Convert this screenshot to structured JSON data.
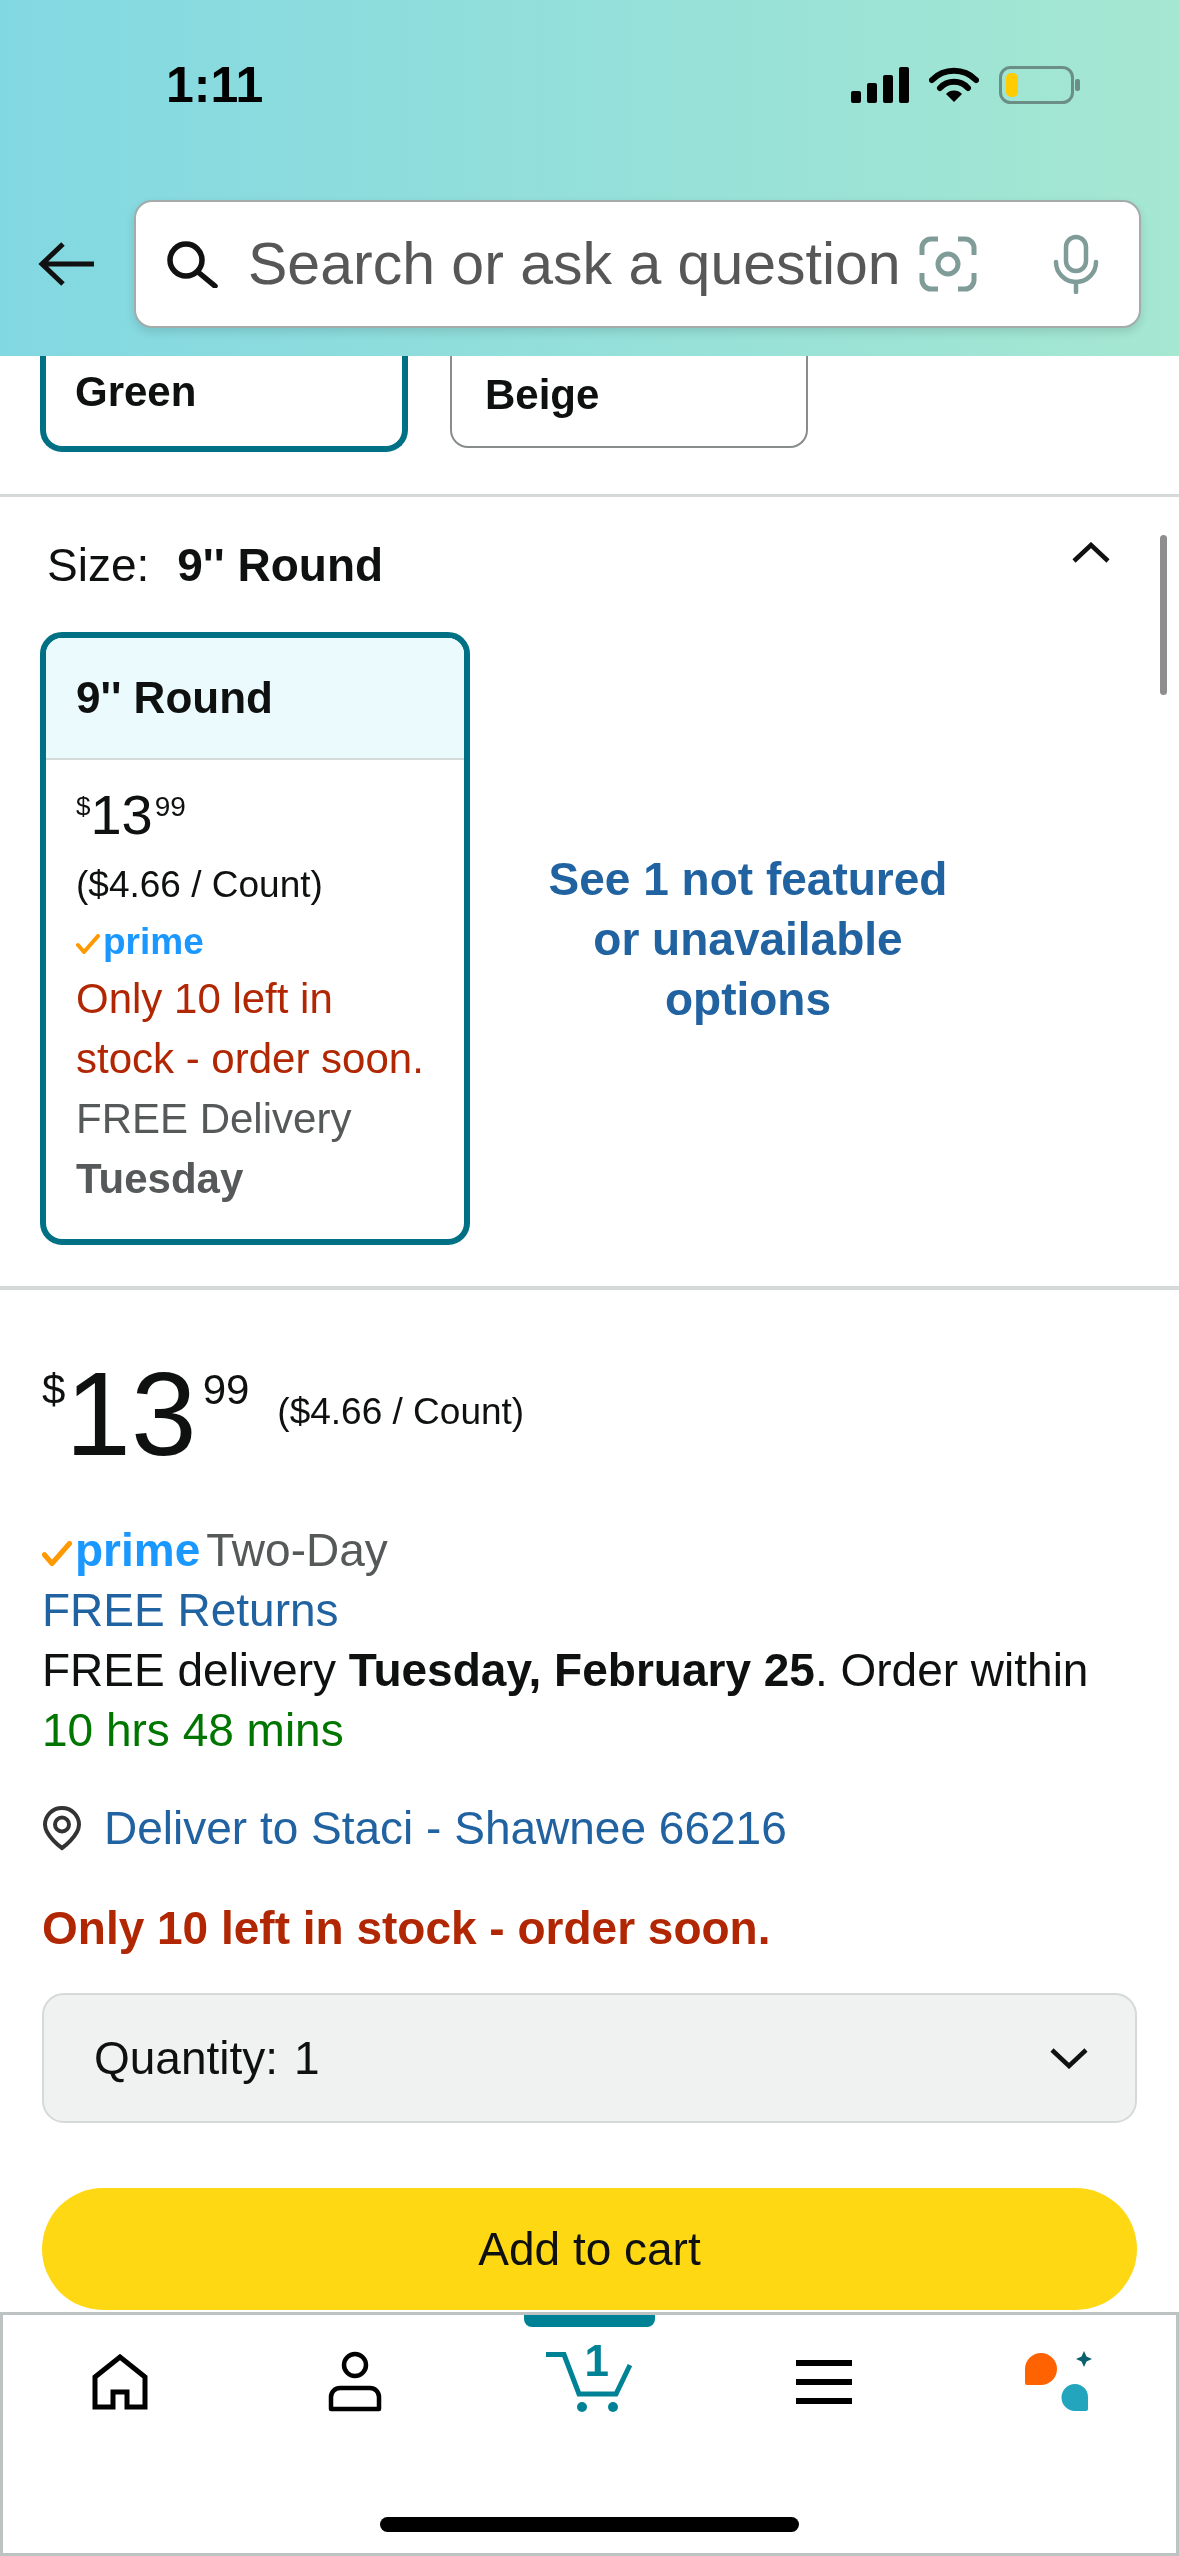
{
  "status_bar": {
    "time": "1:11"
  },
  "search": {
    "placeholder": "Search or ask a question"
  },
  "color_options": [
    {
      "label": "Green",
      "selected": true
    },
    {
      "label": "Beige",
      "selected": false
    }
  ],
  "size": {
    "label": "Size:",
    "value": "9'' Round",
    "expanded": true,
    "options": [
      {
        "name": "9'' Round",
        "selected": true,
        "price": {
          "symbol": "$",
          "whole": "13",
          "fraction": "99"
        },
        "unit_price": "($4.66 / Count)",
        "prime": "prime",
        "stock": "Only 10 left in stock - order soon.",
        "delivery": "FREE Delivery",
        "delivery_day": "Tuesday"
      }
    ],
    "more_options": "See 1 not featured or unavailable options"
  },
  "buy_box": {
    "price": {
      "symbol": "$",
      "whole": "13",
      "fraction": "99"
    },
    "unit_price": "($4.66 / Count)",
    "prime": "prime",
    "shipping_speed": "Two-Day",
    "returns": "FREE Returns",
    "delivery": "FREE delivery **Tuesday, February 25**. Order within",
    "countdown": "10 hrs 48 mins",
    "deliver_to": "Deliver to Staci - Shawnee 66216",
    "stock": "Only 10 left in stock - order soon.",
    "quantity": {
      "label": "Quantity:",
      "value": "1"
    },
    "add_to_cart": "Add to cart"
  },
  "bottom_nav": [
    {
      "kind": "home",
      "selected": false
    },
    {
      "kind": "account",
      "selected": false
    },
    {
      "kind": "cart",
      "selected": true,
      "badge": "1"
    },
    {
      "kind": "menu",
      "selected": false
    },
    {
      "kind": "assistant",
      "selected": false
    }
  ]
}
